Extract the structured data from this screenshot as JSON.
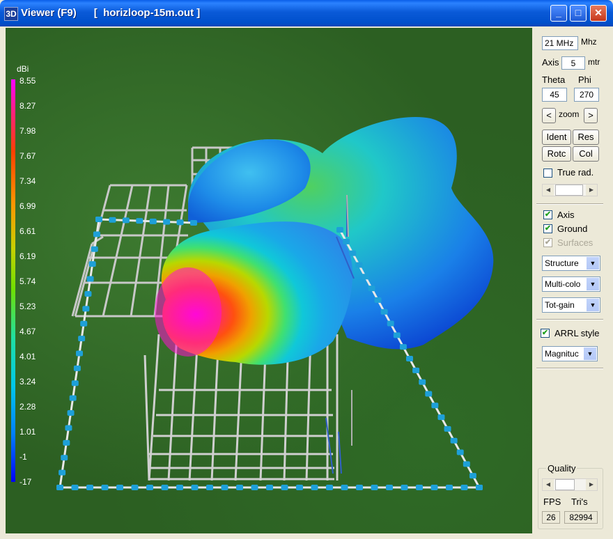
{
  "window": {
    "title": "Viewer (F9)      [  horizloop-15m.out ]",
    "icon": "3D",
    "minimize": "_",
    "maximize": "□",
    "close": "✕"
  },
  "legend": {
    "unit": "dBi",
    "ticks": [
      "8.55",
      "8.27",
      "7.98",
      "7.67",
      "7.34",
      "6.99",
      "6.61",
      "6.19",
      "5.74",
      "5.23",
      "4.67",
      "4.01",
      "3.24",
      "2.28",
      "1.01",
      "-1",
      "-17"
    ]
  },
  "panel": {
    "frequency_value": "21 MHz",
    "frequency_unit": "Mhz",
    "axis_label": "Axis",
    "axis_value": "5",
    "axis_unit": "mtr",
    "theta_label": "Theta",
    "phi_label": "Phi",
    "theta_value": "45",
    "phi_value": "270",
    "zoom_label": "zoom",
    "zoom_left": "<",
    "zoom_right": ">",
    "ident": "Ident",
    "res": "Res",
    "rotc": "Rotc",
    "col": "Col",
    "true_rad": "True rad.",
    "axis_check": "Axis",
    "ground_check": "Ground",
    "surfaces_check": "Surfaces",
    "structure_select": "Structure",
    "color_select": "Multi-colo",
    "gain_select": "Tot-gain",
    "arrl_style": "ARRL style",
    "magnitude_select": "Magnituc",
    "quality_label": "Quality",
    "fps_label": "FPS",
    "tris_label": "Tri's",
    "fps_value": "26",
    "tris_value": "82994"
  }
}
